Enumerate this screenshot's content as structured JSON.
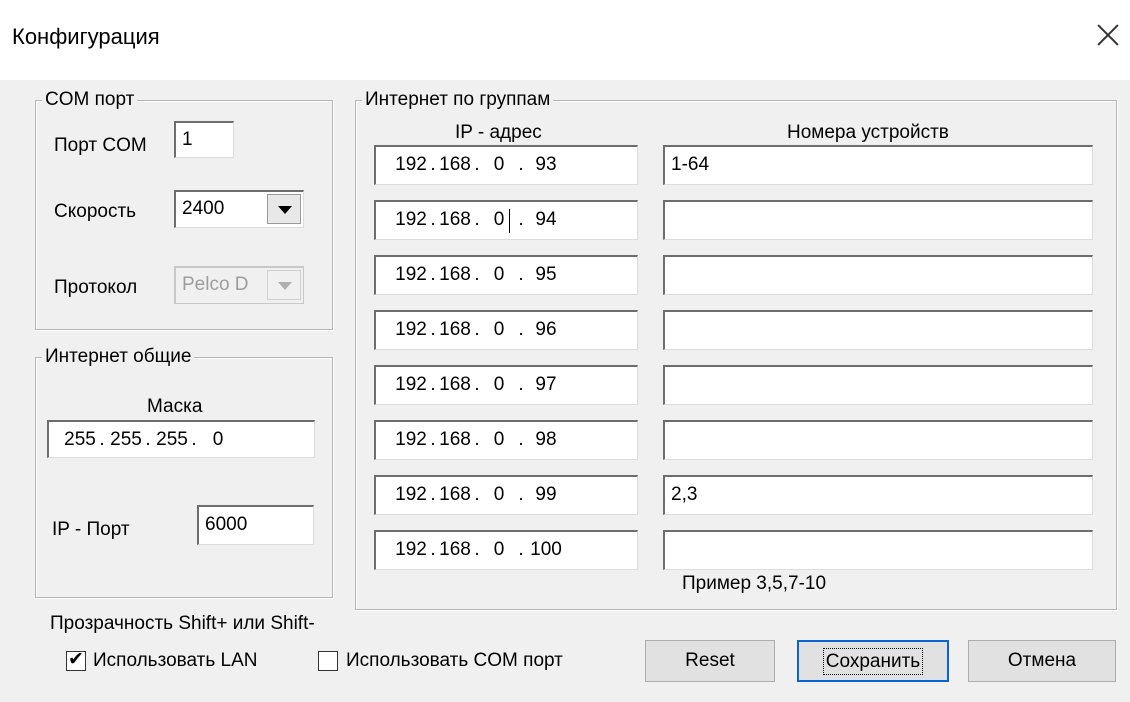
{
  "window": {
    "title": "Конфигурация"
  },
  "com_group": {
    "legend": "COM порт",
    "port_label": "Порт  COM",
    "port_value": "1",
    "speed_label": "Скорость",
    "speed_value": "2400",
    "protocol_label": "Протокол",
    "protocol_value": "Pelco D"
  },
  "inet_general": {
    "legend": "Интернет общие",
    "mask_label": "Маска",
    "mask": [
      "255",
      "255",
      "255",
      "0"
    ],
    "ip_port_label": "IP - Порт",
    "ip_port_value": "6000"
  },
  "inet_groups": {
    "legend": "Интернет по группам",
    "ip_header": "IP - адрес",
    "devices_header": "Номера устройств",
    "rows": [
      {
        "ip": [
          "192",
          "168",
          "0",
          "93"
        ],
        "devices": "1-64"
      },
      {
        "ip": [
          "192",
          "168",
          "0",
          "94"
        ],
        "devices": ""
      },
      {
        "ip": [
          "192",
          "168",
          "0",
          "95"
        ],
        "devices": ""
      },
      {
        "ip": [
          "192",
          "168",
          "0",
          "96"
        ],
        "devices": ""
      },
      {
        "ip": [
          "192",
          "168",
          "0",
          "97"
        ],
        "devices": ""
      },
      {
        "ip": [
          "192",
          "168",
          "0",
          "98"
        ],
        "devices": ""
      },
      {
        "ip": [
          "192",
          "168",
          "0",
          "99"
        ],
        "devices": "2,3"
      },
      {
        "ip": [
          "192",
          "168",
          "0",
          "100"
        ],
        "devices": ""
      }
    ],
    "example": "Пример 3,5,7-10"
  },
  "footer": {
    "transparency_hint": "Прозрачность Shift+ или Shift-",
    "use_lan_label": "Использовать LAN",
    "use_lan_checked": true,
    "use_com_label": "Использовать COM порт",
    "use_com_checked": false,
    "reset_label": "Reset",
    "save_label": "Сохранить",
    "cancel_label": "Отмена"
  }
}
